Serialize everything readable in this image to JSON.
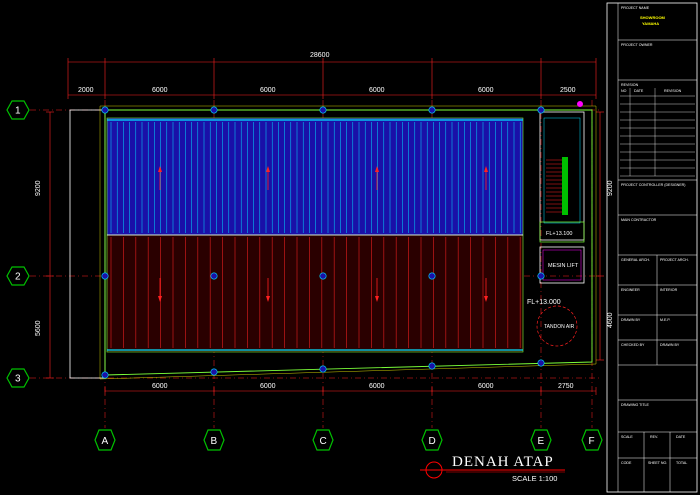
{
  "drawing": {
    "title": "DENAH ATAP",
    "scale": "SCALE 1:100",
    "overall_dimension": "28600",
    "top_dims": [
      "2000",
      "6000",
      "6000",
      "6000",
      "6000",
      "2500"
    ],
    "bottom_dims": [
      "6000",
      "6000",
      "6000",
      "6000",
      "2750"
    ],
    "left_dims": [
      "9200",
      "5600"
    ],
    "right_dims": [
      "9200",
      "4600"
    ],
    "grid_columns": [
      "A",
      "B",
      "C",
      "D",
      "E",
      "F"
    ],
    "grid_rows": [
      "1",
      "2",
      "3"
    ],
    "labels": {
      "fl_stair": "FL+13.100",
      "mesin_lift": "MESIN LIFT",
      "fl_roof": "FL+13.000",
      "tandon_air": "TANDON AIR"
    }
  },
  "title_block": {
    "project_name_label": "PROJECT NAME",
    "project_name": "SHOWROOM",
    "project_name_2": "YAMAHA",
    "project_owner_label": "PROJECT OWNER",
    "revision_label": "REVISION",
    "revision_cols": [
      "NO",
      "DATE",
      "REVISION"
    ],
    "consultant_label": "PROJECT CONTROLLER (DESIGNER)",
    "main_contractor_label": "MAIN CONTRACTOR",
    "general_arch_label": "GENERAL ARCH.",
    "project_arch_label": "PROJECT ARCH.",
    "engineer_label": "ENGINEER",
    "interior_label": "INTERIOR",
    "drawn_label": "DRAWN BY",
    "mep_label": "M.E.P.",
    "checked_label": "CHECKED BY",
    "approved_label": "DRAWN BY",
    "drawing_title_label": "DRAWING TITLE",
    "scale_label": "SCALE",
    "rev_label": "REV.",
    "date_label": "DATE",
    "code_label": "CODE",
    "sheet_label": "SHEET NO.",
    "total_label": "TOTAL"
  },
  "colors": {
    "background": "#000000",
    "grid_line": "#ff2020",
    "roof_blue": "#1a10a8",
    "roof_red": "#cc1a1a",
    "bubble": "#00c000",
    "outline_green": "#7cff3a",
    "magenta": "#ff00ff",
    "cyan": "#00e0ff",
    "title_red": "#ff0000"
  }
}
